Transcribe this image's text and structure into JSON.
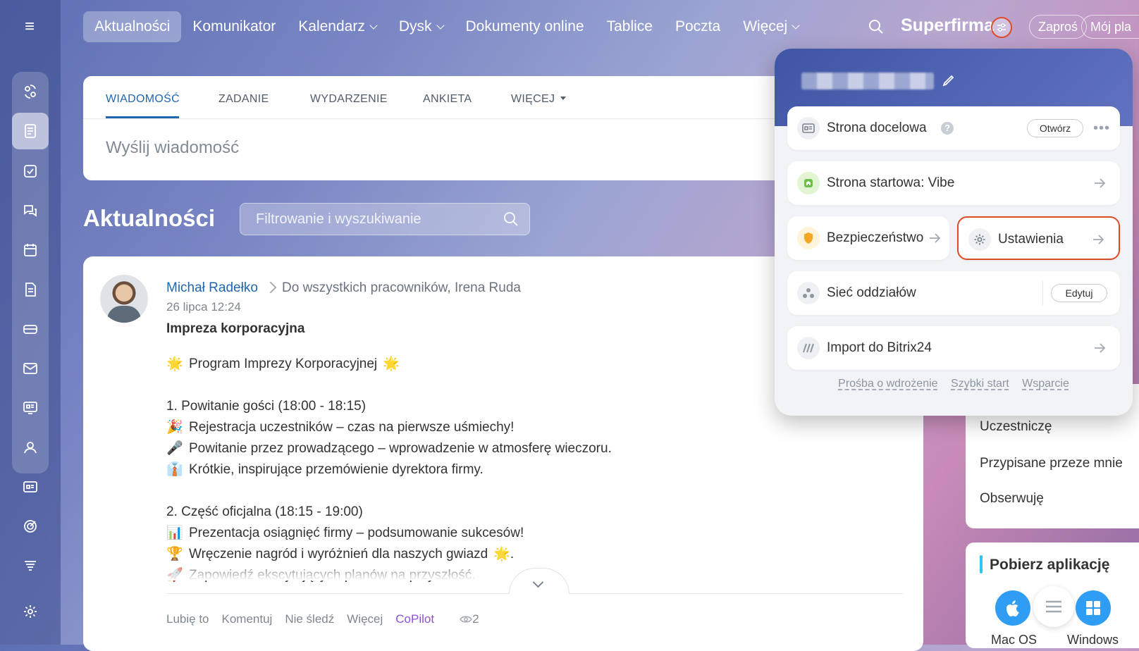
{
  "nav": {
    "items": [
      {
        "label": "Aktualności",
        "active": true,
        "dropdown": false
      },
      {
        "label": "Komunikator",
        "active": false,
        "dropdown": false
      },
      {
        "label": "Kalendarz",
        "active": false,
        "dropdown": true
      },
      {
        "label": "Dysk",
        "active": false,
        "dropdown": true
      },
      {
        "label": "Dokumenty online",
        "active": false,
        "dropdown": false
      },
      {
        "label": "Tablice",
        "active": false,
        "dropdown": false
      },
      {
        "label": "Poczta",
        "active": false,
        "dropdown": false
      },
      {
        "label": "Więcej",
        "active": false,
        "dropdown": true
      }
    ],
    "brand": "Superfirma",
    "invite_label": "Zaproś",
    "plan_label": "Mój pla"
  },
  "sidebar": {
    "icons": [
      "copilot-icon",
      "feed-icon",
      "tasks-icon",
      "chat-icon",
      "calendar-icon",
      "documents-icon",
      "crm-icon",
      "mail-icon",
      "sites-icon",
      "employees-icon",
      "contact-center-icon",
      "goals-icon",
      "automation-icon",
      "settings-icon"
    ]
  },
  "composer": {
    "tabs": [
      "WIADOMOŚĆ",
      "ZADANIE",
      "WYDARZENIE",
      "ANKIETA",
      "WIĘCEJ"
    ],
    "placeholder": "Wyślij wiadomość"
  },
  "page": {
    "title": "Aktualności",
    "filter_placeholder": "Filtrowanie i wyszukiwanie"
  },
  "post": {
    "author": "Michał Radełko",
    "recipients": "Do wszystkich pracowników, Irena Ruda",
    "date": "26 lipca 12:24",
    "title": "Impreza korporacyjna",
    "lines": [
      {
        "emoji": "🌟",
        "text": "Program Imprezy Korporacyjnej",
        "trail": "🌟"
      },
      {
        "gap": true
      },
      {
        "emoji": "",
        "text": "1. Powitanie gości (18:00 - 18:15)"
      },
      {
        "emoji": "🎉",
        "text": "Rejestracja uczestników – czas na pierwsze uśmiechy!"
      },
      {
        "emoji": "🎤",
        "text": "Powitanie przez prowadzącego – wprowadzenie w atmosferę wieczoru."
      },
      {
        "emoji": "👔",
        "text": "Krótkie, inspirujące przemówienie dyrektora firmy."
      },
      {
        "gap": true
      },
      {
        "emoji": "",
        "text": "2. Część oficjalna (18:15 - 19:00)"
      },
      {
        "emoji": "📊",
        "text": "Prezentacja osiągnięć firmy – podsumowanie sukcesów!"
      },
      {
        "emoji": "🏆",
        "text": "Wręczenie nagród i wyróżnień dla naszych gwiazd",
        "trail": "🌟."
      },
      {
        "emoji": "🚀",
        "text": "Zapowiedź ekscytujących planów na przyszłość."
      }
    ],
    "actions": {
      "like": "Lubię to",
      "comment": "Komentuj",
      "unfollow": "Nie śledź",
      "more": "Więcej",
      "copilot": "CoPilot",
      "views": "2"
    }
  },
  "right_panel": {
    "items": [
      "Uczestniczę",
      "Przypisane przeze mnie",
      "Obserwuję"
    ],
    "apps_title": "Pobierz aplikację",
    "apps": [
      "Mac OS",
      "Windows"
    ]
  },
  "dropdown": {
    "landing": {
      "label": "Strona docelowa",
      "help": "?",
      "open_label": "Otwórz",
      "dots": "•••"
    },
    "start_page": {
      "label": "Strona startowa: Vibe"
    },
    "security": {
      "label": "Bezpieczeństwo"
    },
    "settings": {
      "label": "Ustawienia"
    },
    "branches": {
      "label": "Sieć oddziałów",
      "edit_label": "Edytuj"
    },
    "import": {
      "label": "Import do Bitrix24"
    },
    "links": [
      "Prośba o wdrożenie",
      "Szybki start",
      "Wsparcie"
    ]
  },
  "colors": {
    "accent_blue": "#2067b0",
    "highlight_red": "#e04b26",
    "copilot_purple": "#8e52d9"
  }
}
